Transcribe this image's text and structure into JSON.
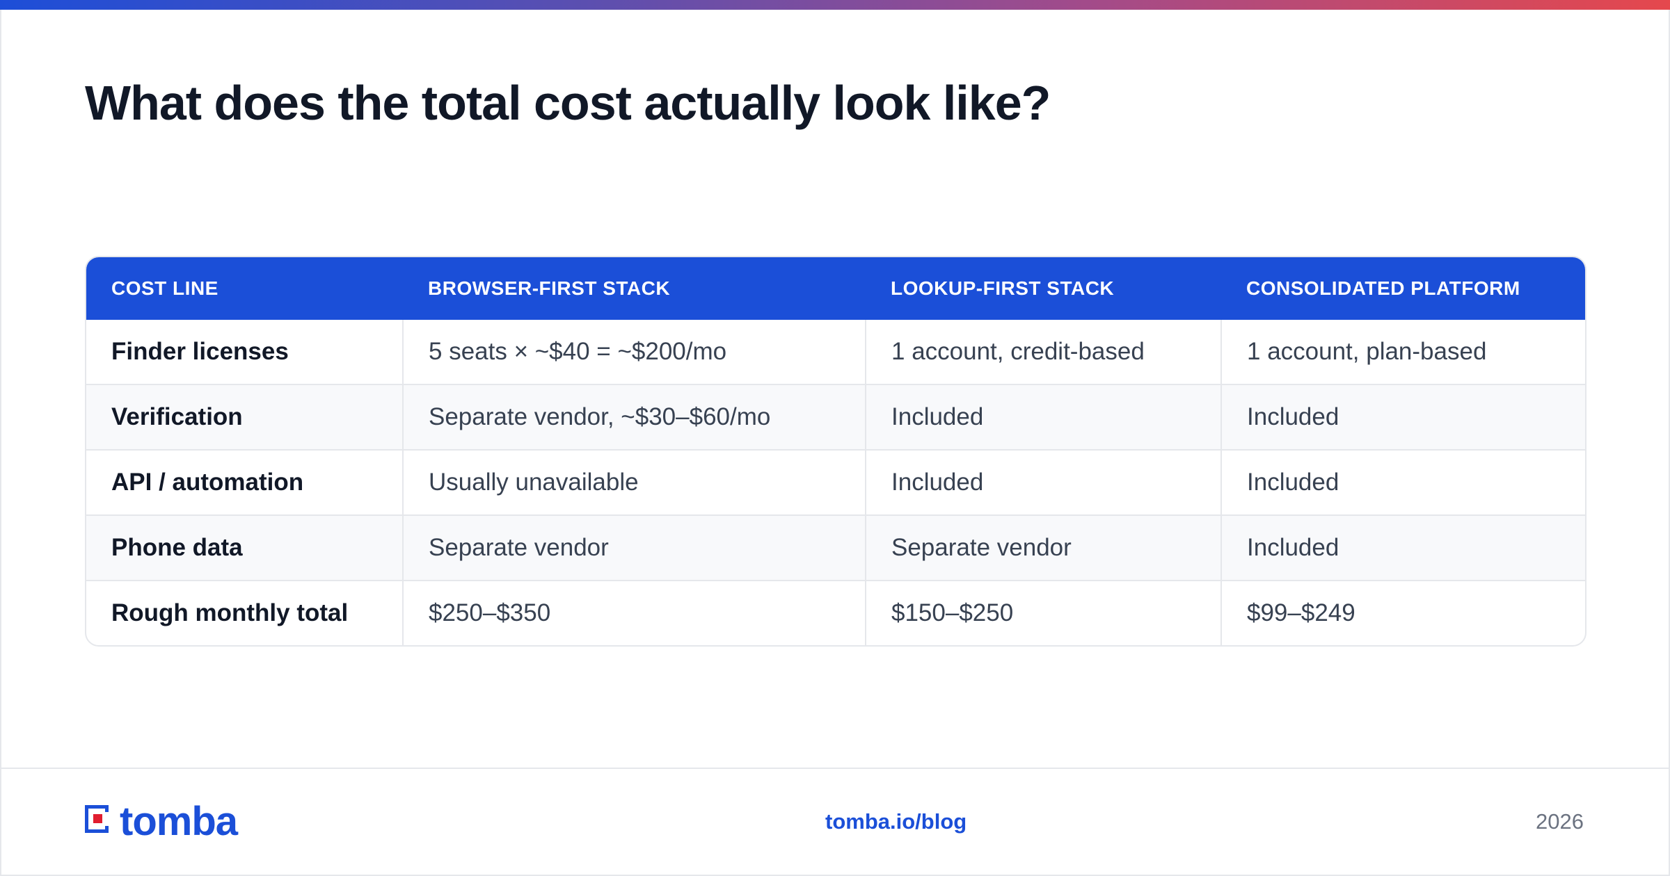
{
  "title": "What does the total cost actually look like?",
  "colors": {
    "accent": "#1b4fd8",
    "brand_red": "#e11d2f",
    "gradient_start": "#1d4ed8",
    "gradient_end": "#e5484d"
  },
  "table": {
    "headers": [
      "COST LINE",
      "BROWSER-FIRST STACK",
      "LOOKUP-FIRST STACK",
      "CONSOLIDATED PLATFORM"
    ],
    "rows": [
      [
        "Finder licenses",
        "5 seats × ~$40 = ~$200/mo",
        "1 account, credit-based",
        "1 account, plan-based"
      ],
      [
        "Verification",
        "Separate vendor, ~$30–$60/mo",
        "Included",
        "Included"
      ],
      [
        "API / automation",
        "Usually unavailable",
        "Included",
        "Included"
      ],
      [
        "Phone data",
        "Separate vendor",
        "Separate vendor",
        "Included"
      ],
      [
        "Rough monthly total",
        "$250–$350",
        "$150–$250",
        "$99–$249"
      ]
    ]
  },
  "footer": {
    "logo_text": "tomba",
    "logo_icon": "tomba-logo-icon",
    "link": "tomba.io/blog",
    "year": "2026"
  }
}
